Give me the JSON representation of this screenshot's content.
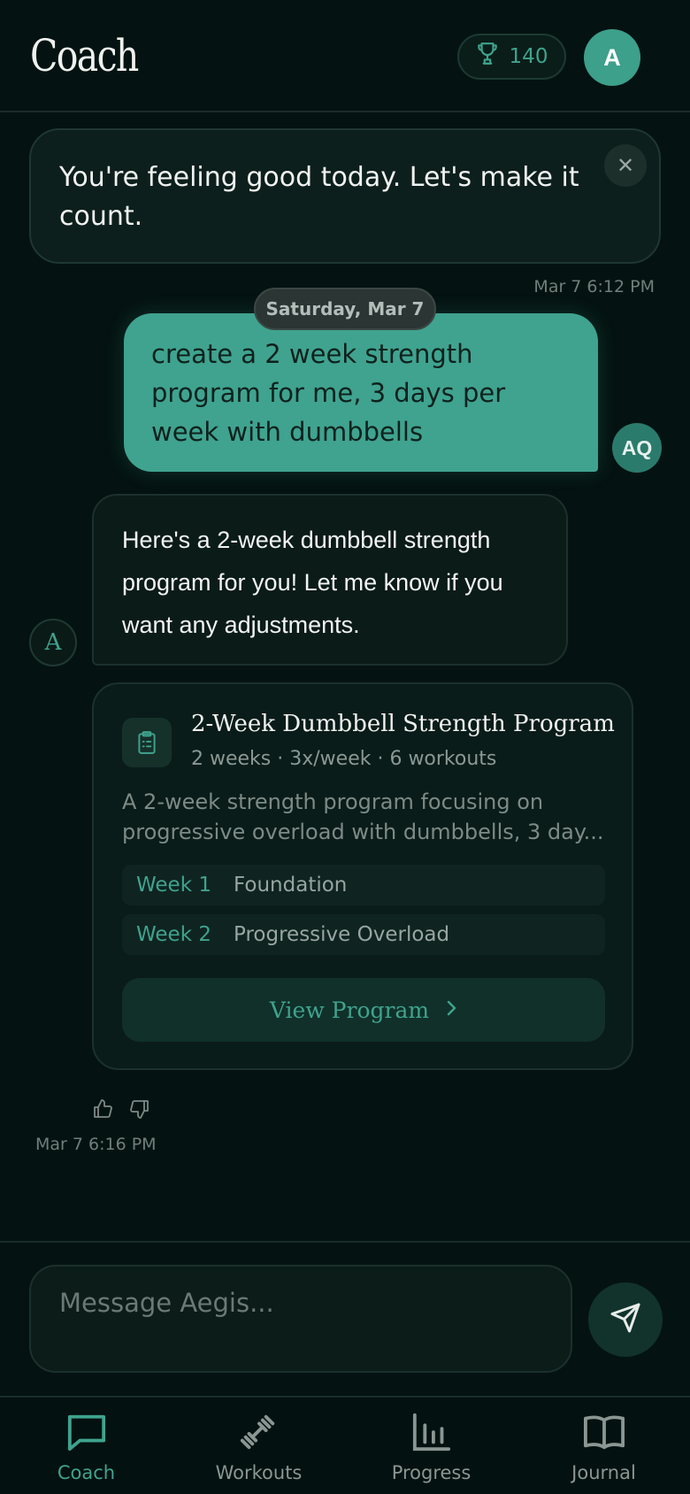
{
  "header": {
    "logo": "Coach",
    "points": "140",
    "avatar_initial": "A"
  },
  "greeting": {
    "text": "You're feeling good today. Let's make it count.",
    "close_glyph": "✕",
    "timestamp": "Mar 7 6:12 PM"
  },
  "date_divider": "Saturday, Mar 7",
  "user_message": {
    "text": "create a 2 week strength program for me, 3 days per week with dumbbells",
    "avatar_initials": "AQ"
  },
  "assistant_message": {
    "avatar_initial": "A",
    "text": "Here's a 2-week dumbbell strength program for you! Let me know if you want any adjustments.",
    "timestamp": "Mar 7 6:16 PM"
  },
  "program_card": {
    "title": "2-Week Dumbbell Strength Program",
    "meta": "2 weeks · 3x/week · 6 workouts",
    "description": "A 2-week strength program focusing on progressive overload with dumbbells, 3 day...",
    "weeks": [
      {
        "label": "Week 1",
        "name": "Foundation"
      },
      {
        "label": "Week 2",
        "name": "Progressive Overload"
      }
    ],
    "view_button": "View Program",
    "view_chevron": "›"
  },
  "composer": {
    "placeholder": "Message Aegis..."
  },
  "nav": {
    "items": [
      {
        "label": "Coach",
        "icon": "chat-icon",
        "active": true
      },
      {
        "label": "Workouts",
        "icon": "dumbbell-icon",
        "active": false
      },
      {
        "label": "Progress",
        "icon": "bar-chart-icon",
        "active": false
      },
      {
        "label": "Journal",
        "icon": "book-icon",
        "active": false
      }
    ]
  },
  "colors": {
    "accent": "#3fa38d",
    "background": "#041311",
    "card": "#0b1c19"
  }
}
